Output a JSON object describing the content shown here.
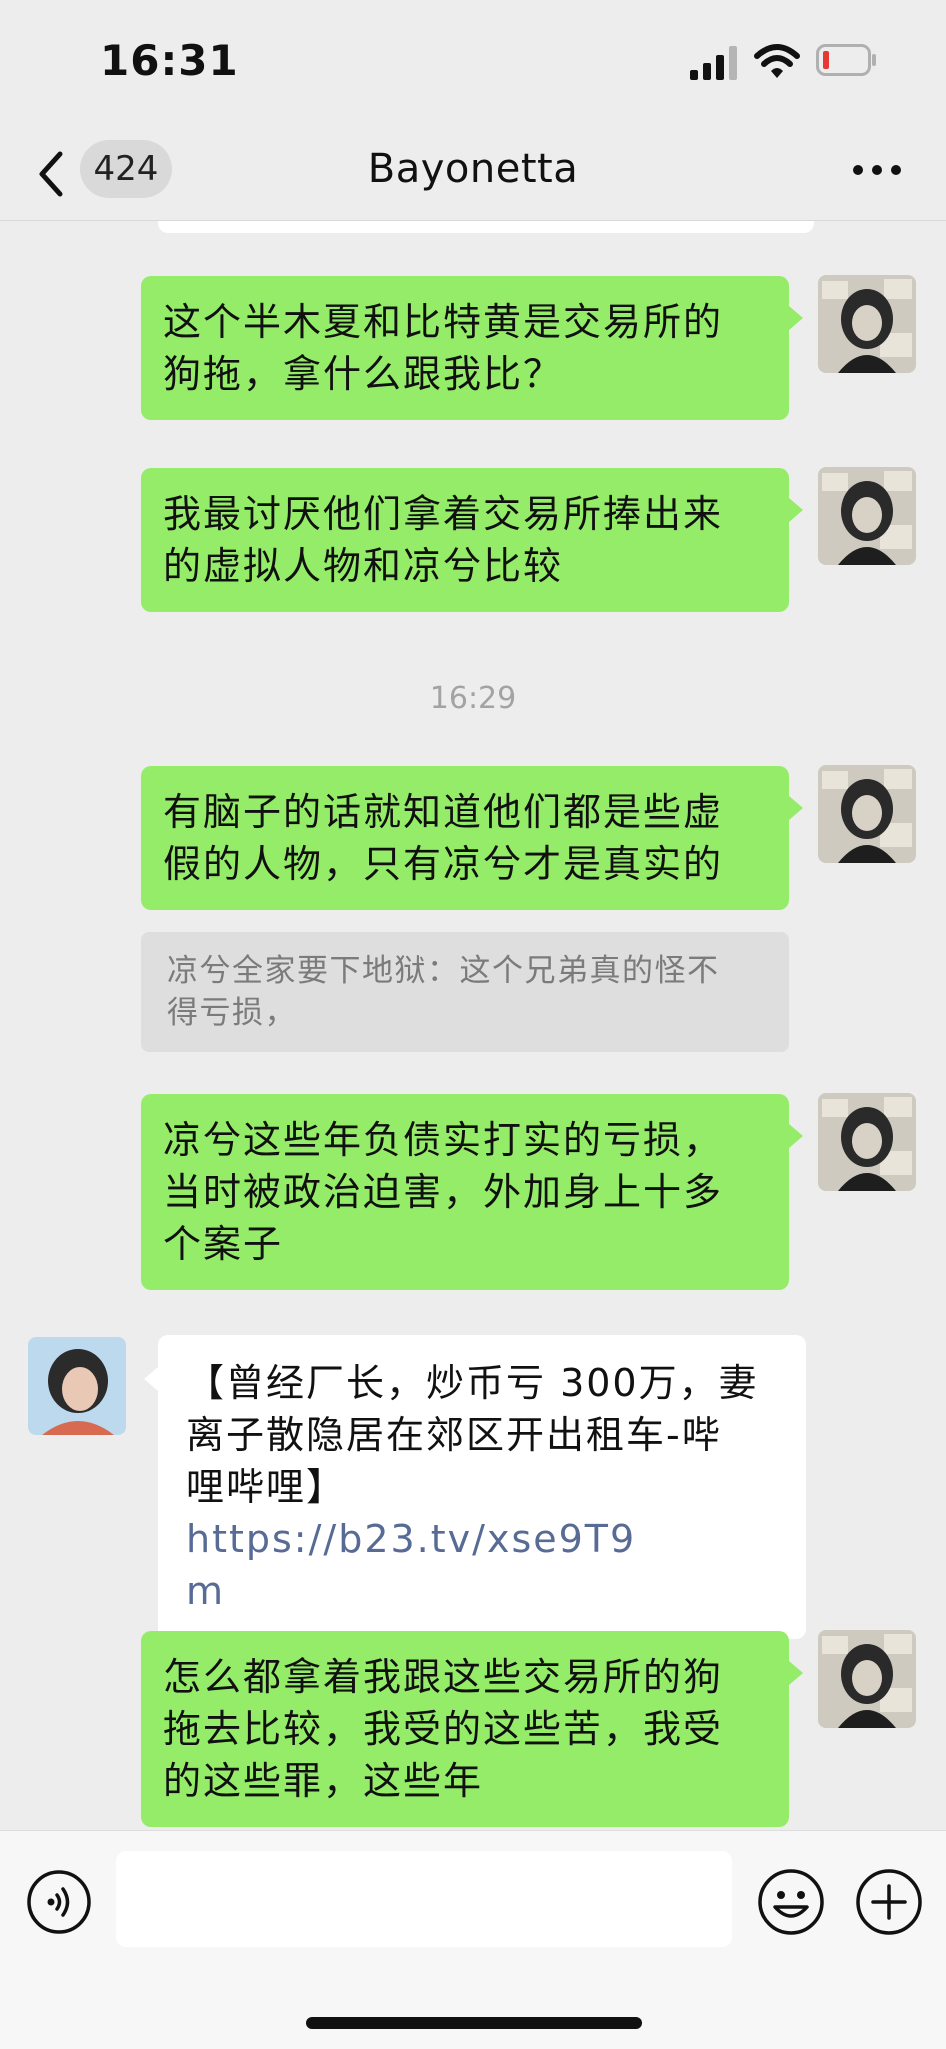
{
  "status_bar": {
    "time": "16:31",
    "icons": [
      "signal-icon",
      "wifi-icon",
      "battery-low-icon"
    ]
  },
  "nav": {
    "unread_count": "424",
    "title": "Bayonetta",
    "icons": [
      "back-chevron-icon",
      "more-dots-icon"
    ]
  },
  "messages": {
    "m1": {
      "lines": [
        "这个半木夏和比特黄是交易所的",
        "狗拖，拿什么跟我比？"
      ]
    },
    "m2": {
      "lines": [
        "我最讨厌他们拿着交易所捧出来",
        "的虚拟人物和凉兮比较"
      ]
    },
    "timestamp": "16:29",
    "m3": {
      "lines": [
        "有脑子的话就知道他们都是些虚",
        "假的人物，只有凉兮才是真实的"
      ]
    },
    "quote": {
      "lines": [
        "凉兮全家要下地狱：这个兄弟真的怪不",
        "得亏损，"
      ]
    },
    "m4": {
      "lines": [
        "凉兮这些年负债实打实的亏损，",
        "当时被政治迫害，外加身上十多",
        "个案子"
      ]
    },
    "m5": {
      "line1": "【曾经厂长，炒币亏 300万，妻",
      "line2": "离子散隐居在郊区开出租车-哔",
      "line3_prefix": "哩哔哩】 ",
      "link_part1": "https://b23.tv/xse9T9",
      "link_part2": "m"
    },
    "m6": {
      "lines": [
        "怎么都拿着我跟这些交易所的狗",
        "拖去比较，我受的这些苦，我受",
        "的这些罪，这些年"
      ]
    }
  },
  "input_bar": {
    "input_value": "",
    "icons": [
      "voice-icon",
      "emoji-icon",
      "plus-icon"
    ]
  },
  "colors": {
    "background": "#ededed",
    "my_bubble": "#95ec69",
    "their_bubble": "#ffffff",
    "quote_bg": "#dedede",
    "link": "#576b95"
  }
}
